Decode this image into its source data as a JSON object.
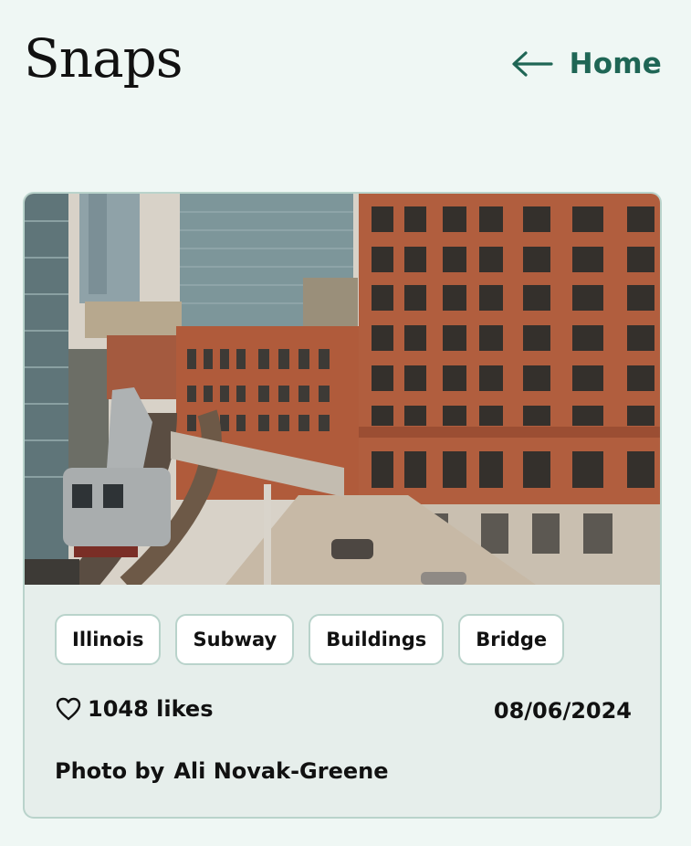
{
  "header": {
    "title": "Snaps",
    "home_label": "Home"
  },
  "card": {
    "photo_alt": "",
    "tags": [
      "Illinois",
      "Subway",
      "Buildings",
      "Bridge"
    ],
    "likes_text": "1048 likes",
    "date": "08/06/2024",
    "credit_prefix": "Photo by",
    "author": "Ali Novak-Greene"
  },
  "icons": {
    "back": "arrow-left-icon",
    "like": "heart-outline-icon"
  },
  "colors": {
    "background": "#eff7f4",
    "accent": "#1f6655",
    "card_bg": "#e6eeeb",
    "border": "#b9d3cb"
  }
}
